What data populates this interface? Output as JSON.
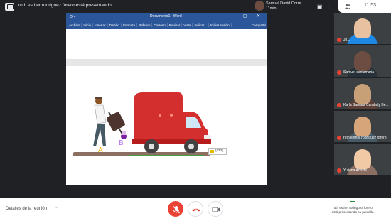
{
  "top": {
    "presenter_text": "ruth esther rodriguez forero está presentando",
    "notification_name": "Samuel David Corre...",
    "notification_time": "1' min",
    "time": "11:53"
  },
  "word": {
    "title": "Documento1 - Word",
    "tabs": [
      "Archivo",
      "Inicio",
      "Insertar",
      "Diseño",
      "Formato",
      "Referen",
      "Corresp",
      "Revisar",
      "Vista",
      "Indicar...",
      "Iniciar sesión"
    ],
    "share": "Compartir",
    "paste_label": "(Ctrl)"
  },
  "scene": {
    "letter_a": "A",
    "letter_b": "B"
  },
  "participants": [
    {
      "name": "Jh...",
      "face": "#e8c1a0",
      "body": "#1e88e5"
    },
    {
      "name": "Samuel santamaria",
      "face": "#6d4c41",
      "body": "#263238"
    },
    {
      "name": "Karla Samara Carabaly Be...",
      "face": "#c8a078",
      "body": "#5d4037"
    },
    {
      "name": "ruth esther rodriguez forero",
      "face": "#d7a57a",
      "body": "#455a64"
    },
    {
      "name": "Yuliana Acosta",
      "face": "#f1c9a5",
      "body": "#8d6e63"
    }
  ],
  "bottom": {
    "details_label": "Detalles de la reunión",
    "present_line1": "ruth esther rodriguez forero",
    "present_line2": "está presentando su pantalla"
  },
  "colors": {
    "word_blue": "#2b579a",
    "meet_red": "#ea4335",
    "truck_red": "#d32f2f"
  }
}
